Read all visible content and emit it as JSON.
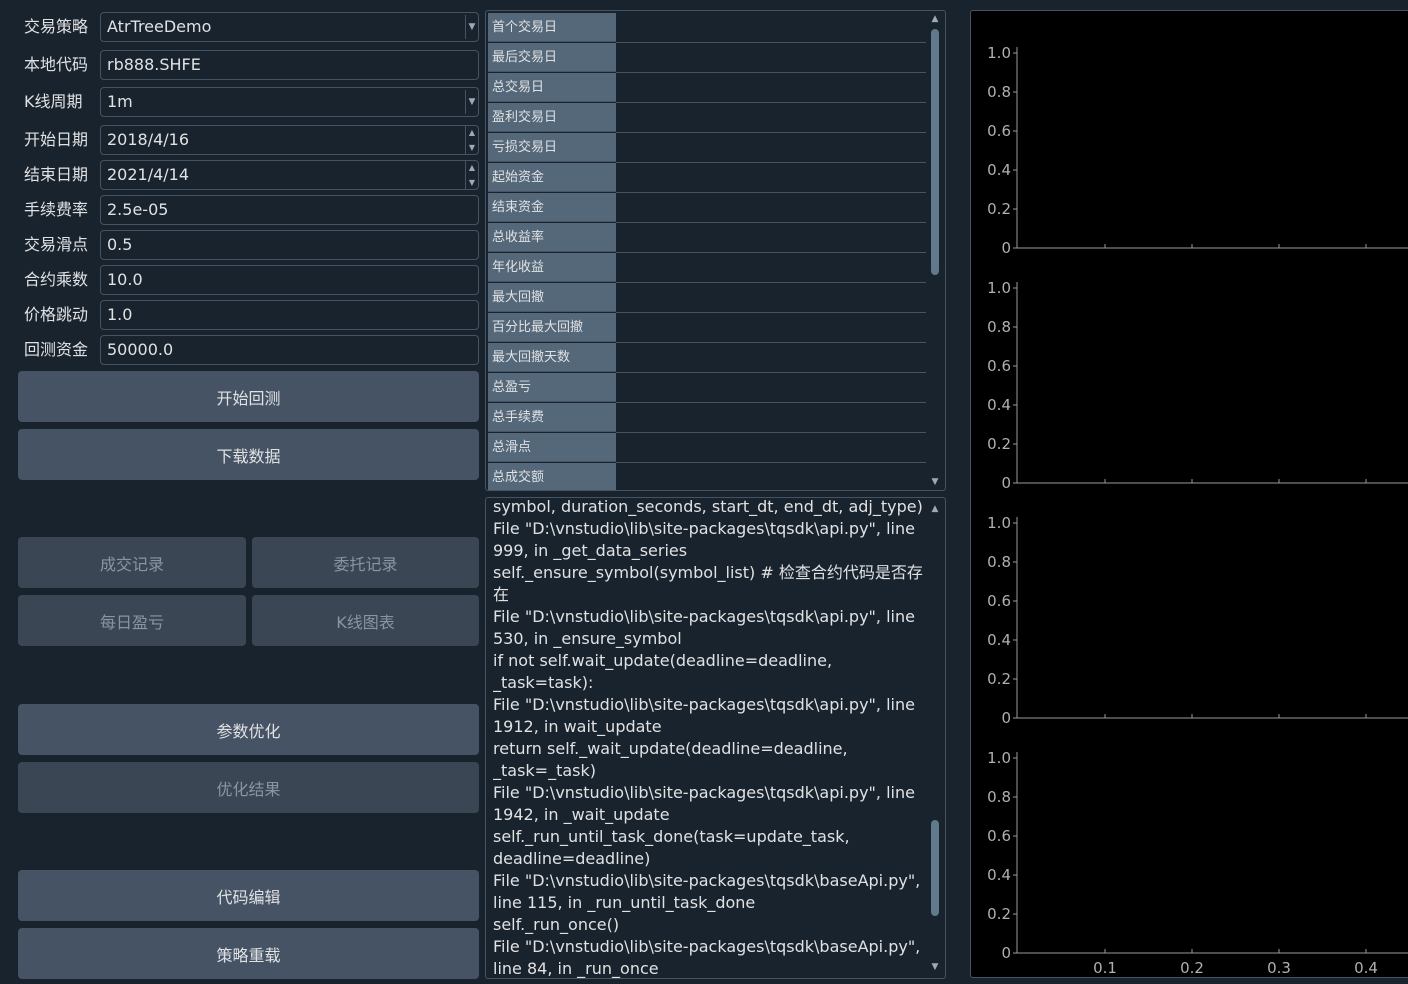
{
  "form": {
    "strategy": {
      "label": "交易策略",
      "value": "AtrTreeDemo"
    },
    "symbol": {
      "label": "本地代码",
      "value": "rb888.SHFE"
    },
    "interval": {
      "label": "K线周期",
      "value": "1m"
    },
    "start_date": {
      "label": "开始日期",
      "value": "2018/4/16"
    },
    "end_date": {
      "label": "结束日期",
      "value": "2021/4/14"
    },
    "rate": {
      "label": "手续费率",
      "value": "2.5e-05"
    },
    "slippage": {
      "label": "交易滑点",
      "value": "0.5"
    },
    "size": {
      "label": "合约乘数",
      "value": "10.0"
    },
    "pricetick": {
      "label": "价格跳动",
      "value": "1.0"
    },
    "capital": {
      "label": "回测资金",
      "value": "50000.0"
    }
  },
  "buttons": {
    "start_backtest": "开始回测",
    "download_data": "下载数据",
    "trade_records": "成交记录",
    "order_records": "委托记录",
    "daily_pnl": "每日盈亏",
    "kline_chart": "K线图表",
    "optimize": "参数优化",
    "optimize_result": "优化结果",
    "edit_code": "代码编辑",
    "reload_strategy": "策略重载"
  },
  "statistics": [
    "首个交易日",
    "最后交易日",
    "总交易日",
    "盈利交易日",
    "亏损交易日",
    "起始资金",
    "结束资金",
    "总收益率",
    "年化收益",
    "最大回撤",
    "百分比最大回撤",
    "最大回撤天数",
    "总盈亏",
    "总手续费",
    "总滑点",
    "总成交额"
  ],
  "log_lines": [
    "symbol, duration_seconds, start_dt, end_dt, adj_type)",
    "  File \"D:\\vnstudio\\lib\\site-packages\\tqsdk\\api.py\", line",
    "999, in _get_data_series",
    "    self._ensure_symbol(symbol_list)  # 检查合约代码是否存",
    "在",
    "  File \"D:\\vnstudio\\lib\\site-packages\\tqsdk\\api.py\", line",
    "530, in _ensure_symbol",
    "    if not self.wait_update(deadline=deadline,",
    "_task=task):",
    "  File \"D:\\vnstudio\\lib\\site-packages\\tqsdk\\api.py\", line",
    "1912, in wait_update",
    "    return self._wait_update(deadline=deadline,",
    "_task=_task)",
    "  File \"D:\\vnstudio\\lib\\site-packages\\tqsdk\\api.py\", line",
    "1942, in _wait_update",
    "    self._run_until_task_done(task=update_task,",
    "deadline=deadline)",
    "  File \"D:\\vnstudio\\lib\\site-packages\\tqsdk\\baseApi.py\",",
    "line 115, in _run_until_task_done",
    "    self._run_once()",
    "  File \"D:\\vnstudio\\lib\\site-packages\\tqsdk\\baseApi.py\",",
    "line 84, in _run_once"
  ],
  "chart_data": {
    "type": "line",
    "panels": 4,
    "y_ticks": [
      "1.0",
      "0.8",
      "0.6",
      "0.4",
      "0.2",
      "0"
    ],
    "x_ticks": [
      "0.1",
      "0.2",
      "0.3",
      "0.4"
    ],
    "ylim": [
      0,
      1.0
    ],
    "series": [],
    "background": "#000000"
  },
  "colors": {
    "accent": "#455364",
    "header": "#54687a",
    "background": "#19232d"
  }
}
